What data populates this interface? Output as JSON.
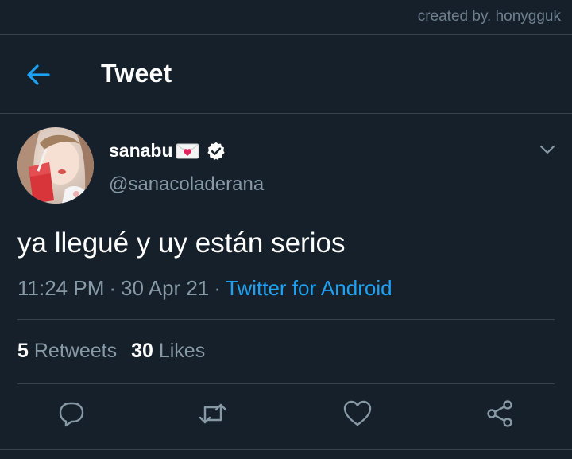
{
  "watermark": "created by. honygguk",
  "header": {
    "title": "Tweet",
    "back_icon": "arrow-left-icon"
  },
  "tweet": {
    "author": {
      "display_name": "sanabu",
      "name_emoji": "envelope-with-heart-icon",
      "verified_icon": "verified-badge-icon",
      "handle": "@sanacoladerana"
    },
    "text": "ya llegué y uy están serios",
    "time": "11:24 PM",
    "date": "30 Apr 21",
    "separator": "·",
    "source": "Twitter for Android",
    "stats": {
      "retweets_count": "5",
      "retweets_label": "Retweets",
      "likes_count": "30",
      "likes_label": "Likes"
    }
  },
  "actions": [
    "reply-icon",
    "retweet-icon",
    "like-icon",
    "share-icon"
  ],
  "colors": {
    "background": "#15202b",
    "accent": "#1da1f2",
    "secondary_text": "#8899a6",
    "divider": "#38444d"
  }
}
